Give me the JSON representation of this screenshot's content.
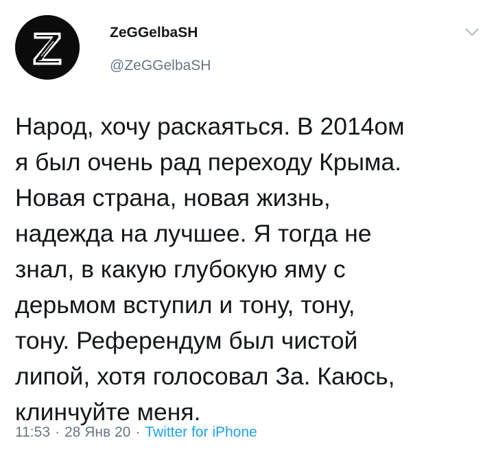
{
  "user": {
    "display_name": "ZeGGelbaSH",
    "handle": "@ZeGGelbaSH",
    "avatar_icon": "z-logo-avatar"
  },
  "tweet": {
    "lines": [
      "Народ, хочу раскаяться. В 2014ом",
      "я был очень рад переходу Крыма.",
      "Новая страна, новая жизнь,",
      "надежда на лучшее. Я тогда не",
      "знал, в какую глубокую яму с",
      "дерьмом вступил и тону, тону,",
      "тону. Референдум был чистой",
      "липой, хотя голосовал За. Каюсь,",
      "клинчуйте меня."
    ]
  },
  "meta": {
    "time": "11:53",
    "separator": "·",
    "date": "28 Янв 20",
    "source": "Twitter for iPhone"
  },
  "colors": {
    "text": "#14171a",
    "secondary": "#657786",
    "link": "#1da1f2"
  }
}
